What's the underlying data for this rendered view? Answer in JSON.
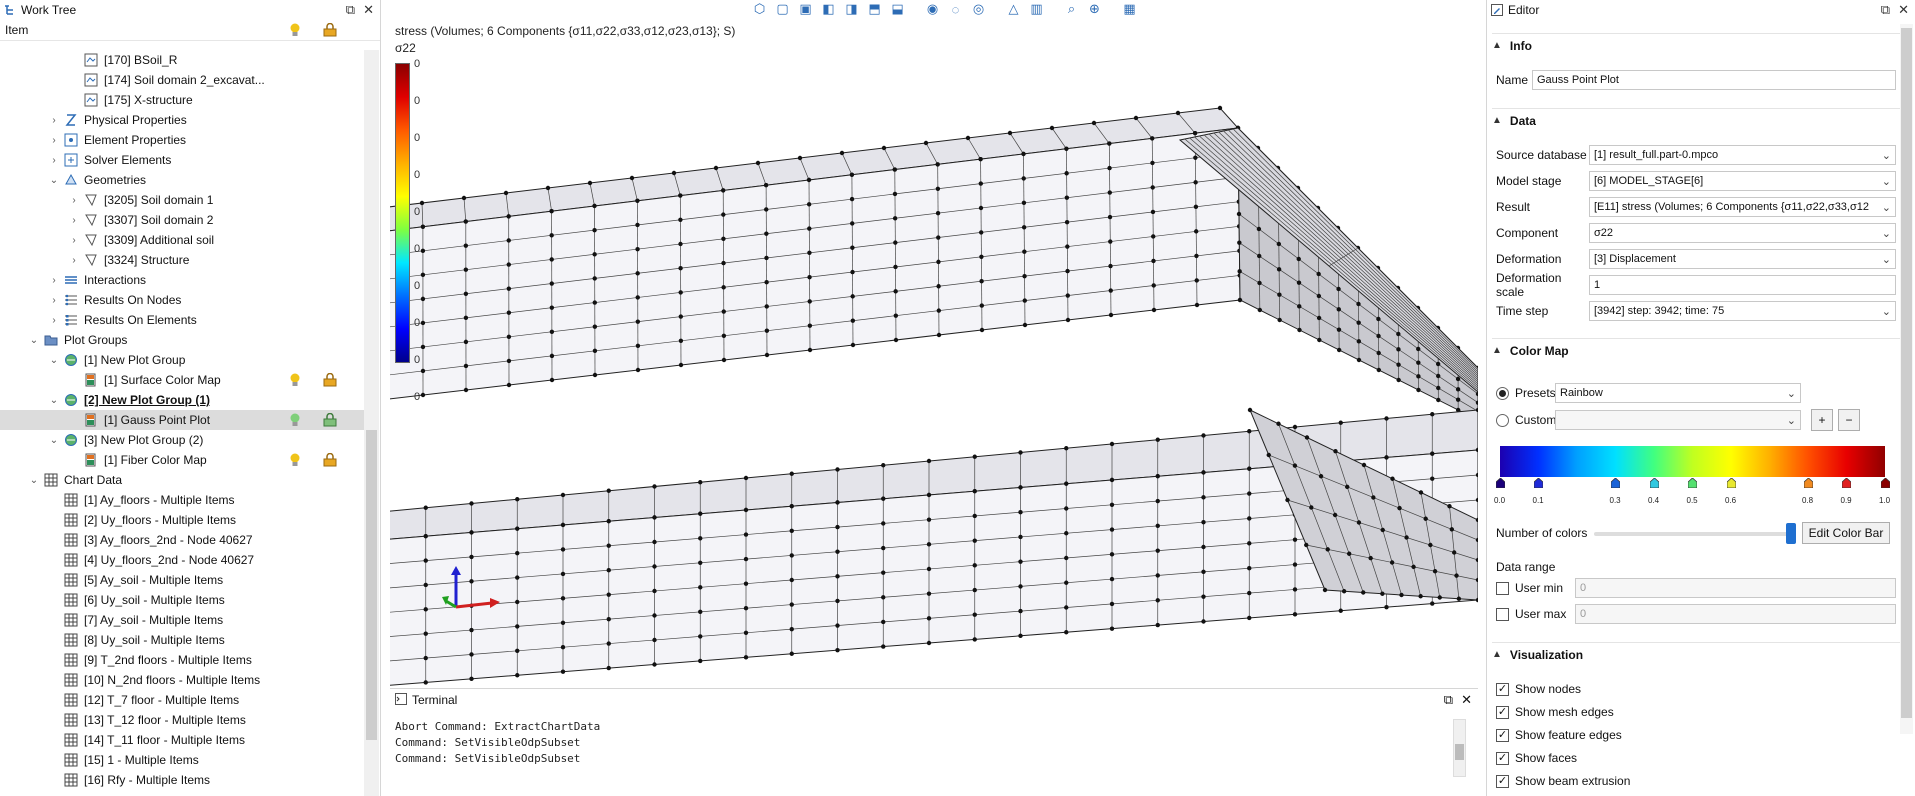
{
  "worktree": {
    "title": "Work Tree",
    "column_header": "Item",
    "rows": [
      {
        "indent": 3,
        "arrow": "none",
        "icon": "mesh-part-icon",
        "label": "[170] BSoil_R"
      },
      {
        "indent": 3,
        "arrow": "none",
        "icon": "mesh-part-icon",
        "label": "[174] Soil domain 2_excavat..."
      },
      {
        "indent": 3,
        "arrow": "none",
        "icon": "mesh-part-icon",
        "label": "[175] X-structure"
      },
      {
        "indent": 2,
        "arrow": "collapsed",
        "icon": "physical-properties-icon",
        "label": "Physical Properties"
      },
      {
        "indent": 2,
        "arrow": "collapsed",
        "icon": "element-properties-icon",
        "label": "Element Properties"
      },
      {
        "indent": 2,
        "arrow": "collapsed",
        "icon": "solver-elements-icon",
        "label": "Solver Elements"
      },
      {
        "indent": 2,
        "arrow": "expanded",
        "icon": "geometries-icon",
        "label": "Geometries"
      },
      {
        "indent": 3,
        "arrow": "collapsed",
        "icon": "geometry-icon",
        "label": "[3205] Soil domain 1"
      },
      {
        "indent": 3,
        "arrow": "collapsed",
        "icon": "geometry-icon",
        "label": "[3307] Soil domain 2"
      },
      {
        "indent": 3,
        "arrow": "collapsed",
        "icon": "geometry-icon",
        "label": "[3309] Additional soil"
      },
      {
        "indent": 3,
        "arrow": "collapsed",
        "icon": "geometry-icon",
        "label": "[3324] Structure"
      },
      {
        "indent": 2,
        "arrow": "collapsed",
        "icon": "interactions-icon",
        "label": "Interactions"
      },
      {
        "indent": 2,
        "arrow": "collapsed",
        "icon": "results-nodes-icon",
        "label": "Results On Nodes"
      },
      {
        "indent": 2,
        "arrow": "collapsed",
        "icon": "results-elements-icon",
        "label": "Results On Elements"
      },
      {
        "indent": 1,
        "arrow": "expanded",
        "icon": "folder-icon",
        "label": "Plot Groups"
      },
      {
        "indent": 2,
        "arrow": "expanded",
        "icon": "plot-group-icon",
        "label": "[1] New Plot Group"
      },
      {
        "indent": 3,
        "arrow": "none",
        "icon": "plot-icon",
        "label": "[1] Surface Color Map",
        "toggles": true
      },
      {
        "indent": 2,
        "arrow": "expanded",
        "icon": "plot-group-icon",
        "label": "[2] New Plot Group (1)",
        "bold": true
      },
      {
        "indent": 3,
        "arrow": "none",
        "icon": "plot-icon",
        "label": "[1] Gauss Point Plot",
        "toggles": true,
        "selected": true
      },
      {
        "indent": 2,
        "arrow": "expanded",
        "icon": "plot-group-icon",
        "label": "[3] New Plot Group (2)"
      },
      {
        "indent": 3,
        "arrow": "none",
        "icon": "plot-icon",
        "label": "[1] Fiber Color Map",
        "toggles": true
      },
      {
        "indent": 1,
        "arrow": "expanded",
        "icon": "table-icon",
        "label": "Chart Data"
      },
      {
        "indent": 2,
        "arrow": "none",
        "icon": "table-icon",
        "label": "[1] Ay_floors - Multiple Items"
      },
      {
        "indent": 2,
        "arrow": "none",
        "icon": "table-icon",
        "label": "[2] Uy_floors - Multiple Items"
      },
      {
        "indent": 2,
        "arrow": "none",
        "icon": "table-icon",
        "label": "[3] Ay_floors_2nd - Node 40627"
      },
      {
        "indent": 2,
        "arrow": "none",
        "icon": "table-icon",
        "label": "[4] Uy_floors_2nd - Node 40627"
      },
      {
        "indent": 2,
        "arrow": "none",
        "icon": "table-icon",
        "label": "[5] Ay_soil - Multiple Items"
      },
      {
        "indent": 2,
        "arrow": "none",
        "icon": "table-icon",
        "label": "[6] Uy_soil - Multiple Items"
      },
      {
        "indent": 2,
        "arrow": "none",
        "icon": "table-icon",
        "label": "[7] Ay_soil - Multiple Items"
      },
      {
        "indent": 2,
        "arrow": "none",
        "icon": "table-icon",
        "label": "[8] Uy_soil - Multiple Items"
      },
      {
        "indent": 2,
        "arrow": "none",
        "icon": "table-icon",
        "label": "[9] T_2nd floors - Multiple Items"
      },
      {
        "indent": 2,
        "arrow": "none",
        "icon": "table-icon",
        "label": "[10] N_2nd floors - Multiple Items"
      },
      {
        "indent": 2,
        "arrow": "none",
        "icon": "table-icon",
        "label": "[12] T_7 floor - Multiple Items"
      },
      {
        "indent": 2,
        "arrow": "none",
        "icon": "table-icon",
        "label": "[13] T_12 floor - Multiple Items"
      },
      {
        "indent": 2,
        "arrow": "none",
        "icon": "table-icon",
        "label": "[14] T_11 floor - Multiple Items"
      },
      {
        "indent": 2,
        "arrow": "none",
        "icon": "table-icon",
        "label": "[15] 1 - Multiple Items"
      },
      {
        "indent": 2,
        "arrow": "none",
        "icon": "table-icon",
        "label": "[16] Rfy - Multiple Items"
      }
    ]
  },
  "viewport": {
    "title": "stress (Volumes; 6 Components {σ11,σ22,σ33,σ12,σ23,σ13}; S)",
    "component": "σ22",
    "legend_ticks": [
      "0",
      "0",
      "0",
      "0",
      "0",
      "0",
      "0",
      "0",
      "0",
      "0"
    ],
    "toolbar_icons": [
      "view-iso-icon",
      "view-front-icon",
      "view-back-icon",
      "view-left-icon",
      "view-right-icon",
      "view-top-icon",
      "view-bottom-icon",
      "eye-show-icon",
      "eye-hide-icon",
      "eye-toggle-icon",
      "measure-icon",
      "clip-icon",
      "zoom-fit-icon",
      "zoom-icon",
      "grid-icon"
    ]
  },
  "terminal": {
    "title": "Terminal",
    "lines": [
      "Abort Command: ExtractChartData",
      "Command: SetVisibleOdpSubset",
      "Command: SetVisibleOdpSubset"
    ]
  },
  "editor": {
    "title": "Editor",
    "info": {
      "header": "Info",
      "name_label": "Name",
      "name_value": "Gauss Point Plot"
    },
    "data": {
      "header": "Data",
      "fields": [
        {
          "label": "Source database",
          "value": "[1] result_full.part-0.mpco",
          "type": "select"
        },
        {
          "label": "Model stage",
          "value": "[6] MODEL_STAGE[6]",
          "type": "select"
        },
        {
          "label": "Result",
          "value": "[E11] stress (Volumes; 6 Components {σ11,σ22,σ33,σ12",
          "type": "select"
        },
        {
          "label": "Component",
          "value": "σ22",
          "type": "select"
        },
        {
          "label": "Deformation",
          "value": "[3] Displacement",
          "type": "select"
        },
        {
          "label": "Deformation scale",
          "value": "1",
          "type": "input"
        },
        {
          "label": "Time step",
          "value": "[3942] step: 3942; time: 75",
          "type": "select"
        }
      ]
    },
    "colormap": {
      "header": "Color Map",
      "presets_label": "Presets",
      "presets_value": "Rainbow",
      "custom_label": "Custom",
      "stops": [
        "0.0",
        "0.1",
        "0.3",
        "0.4",
        "0.5",
        "0.6",
        "0.8",
        "0.9",
        "1.0"
      ],
      "stop_colors": [
        "#1a007a",
        "#1f2bd8",
        "#1a63d8",
        "#2fc8e0",
        "#55e070",
        "#e8e830",
        "#f08a20",
        "#e02020",
        "#8b0000"
      ],
      "num_colors_label": "Number of colors",
      "edit_button": "Edit Color Bar",
      "data_range_label": "Data range",
      "user_min_label": "User min",
      "user_min_value": "0",
      "user_max_label": "User max",
      "user_max_value": "0"
    },
    "visualization": {
      "header": "Visualization",
      "options": [
        {
          "label": "Show nodes",
          "checked": true
        },
        {
          "label": "Show mesh edges",
          "checked": true
        },
        {
          "label": "Show feature edges",
          "checked": true
        },
        {
          "label": "Show faces",
          "checked": true
        },
        {
          "label": "Show beam extrusion",
          "checked": true
        }
      ]
    }
  }
}
